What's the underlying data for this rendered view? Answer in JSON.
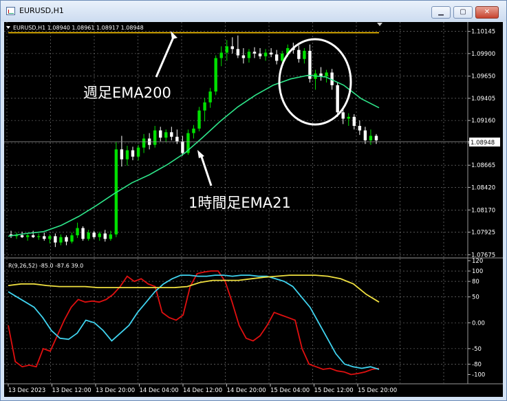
{
  "window": {
    "title": "EURUSD,H1",
    "min_glyph": "▁",
    "max_glyph": "▢",
    "close_glyph": "✕"
  },
  "main_panel": {
    "header": "EURUSD,H1  1.08940 1.08961 1.08917 1.08948",
    "price_label": "1.08948",
    "annotation_weekly": "週足EMA200",
    "annotation_hourly": "1時間足EMA21"
  },
  "sub_panel": {
    "header": "R(9,26,52) -85.0 -87.6 39.0"
  },
  "colors": {
    "background": "#000000",
    "grid": "#8a8a8a",
    "candle_bull": "#00e000",
    "candle_bear": "#ffffff",
    "ema21": "#2ee68a",
    "ema200": "#ffc800",
    "osc_red": "#e01010",
    "osc_cyan": "#40d4f0",
    "osc_yellow": "#f0e040",
    "text": "#ffffff"
  },
  "chart_data": [
    {
      "type": "candlestick",
      "title": "EURUSD,H1",
      "y_ticks": [
        "1.10145",
        "1.09900",
        "1.09650",
        "1.09405",
        "1.09160",
        "1.08910",
        "1.08665",
        "1.08420",
        "1.08170",
        "1.07925",
        "1.07675"
      ],
      "ylim": [
        1.0767,
        1.1015
      ],
      "last_price": 1.08948,
      "x_ticks": [
        "13 Dec 2023",
        "13 Dec 12:00",
        "13 Dec 20:00",
        "14 Dec 04:00",
        "14 Dec 12:00",
        "14 Dec 20:00",
        "15 Dec 04:00",
        "15 Dec 12:00",
        "15 Dec 20:00"
      ],
      "candles": [
        [
          1.079,
          1.0794,
          1.0786,
          1.0788
        ],
        [
          1.0788,
          1.0792,
          1.0785,
          1.0789
        ],
        [
          1.0789,
          1.0793,
          1.0786,
          1.0787
        ],
        [
          1.0787,
          1.0791,
          1.0783,
          1.0789
        ],
        [
          1.0789,
          1.0794,
          1.0786,
          1.0787
        ],
        [
          1.0787,
          1.0791,
          1.0784,
          1.0788
        ],
        [
          1.0788,
          1.0792,
          1.0783,
          1.0785
        ],
        [
          1.0785,
          1.079,
          1.078,
          1.0788
        ],
        [
          1.0788,
          1.0791,
          1.0776,
          1.0781
        ],
        [
          1.0781,
          1.079,
          1.0778,
          1.0787
        ],
        [
          1.0787,
          1.0789,
          1.0778,
          1.0782
        ],
        [
          1.0782,
          1.0792,
          1.078,
          1.0789
        ],
        [
          1.0789,
          1.0803,
          1.0786,
          1.0797
        ],
        [
          1.0797,
          1.0799,
          1.0783,
          1.0785
        ],
        [
          1.0785,
          1.0795,
          1.0783,
          1.0792
        ],
        [
          1.0792,
          1.0794,
          1.0785,
          1.0787
        ],
        [
          1.0787,
          1.0793,
          1.0783,
          1.0791
        ],
        [
          1.0791,
          1.0795,
          1.0782,
          1.0785
        ],
        [
          1.0785,
          1.0794,
          1.0783,
          1.079
        ],
        [
          1.079,
          1.0892,
          1.0787,
          1.0884
        ],
        [
          1.0884,
          1.0899,
          1.0865,
          1.0873
        ],
        [
          1.0873,
          1.0888,
          1.0866,
          1.0883
        ],
        [
          1.0883,
          1.0887,
          1.0872,
          1.0876
        ],
        [
          1.0876,
          1.0889,
          1.0872,
          1.0886
        ],
        [
          1.0886,
          1.0901,
          1.088,
          1.0896
        ],
        [
          1.0896,
          1.0902,
          1.0884,
          1.0889
        ],
        [
          1.0889,
          1.091,
          1.0886,
          1.0905
        ],
        [
          1.0905,
          1.0909,
          1.0893,
          1.0897
        ],
        [
          1.0897,
          1.0906,
          1.0892,
          1.0903
        ],
        [
          1.0903,
          1.0909,
          1.0894,
          1.0898
        ],
        [
          1.0898,
          1.0906,
          1.089,
          1.0893
        ],
        [
          1.0893,
          1.0899,
          1.0877,
          1.088
        ],
        [
          1.088,
          1.0906,
          1.0878,
          1.0902
        ],
        [
          1.0902,
          1.0911,
          1.0896,
          1.0907
        ],
        [
          1.0907,
          1.0931,
          1.0904,
          1.0927
        ],
        [
          1.0927,
          1.0941,
          1.0915,
          1.0936
        ],
        [
          1.0936,
          1.0952,
          1.093,
          1.0948
        ],
        [
          1.0948,
          1.0988,
          1.0944,
          1.0985
        ],
        [
          1.0985,
          1.0998,
          1.0976,
          1.0991
        ],
        [
          1.0991,
          1.1005,
          1.0982,
          1.0998
        ],
        [
          1.0998,
          1.1008,
          1.099,
          1.0995
        ],
        [
          1.0995,
          1.101,
          1.0985,
          1.0988
        ],
        [
          1.0988,
          1.0996,
          1.0979,
          1.0985
        ],
        [
          1.0985,
          1.0995,
          1.098,
          1.0992
        ],
        [
          1.0992,
          1.0997,
          1.0985,
          1.099
        ],
        [
          1.099,
          1.0996,
          1.0984,
          1.0987
        ],
        [
          1.0987,
          1.0995,
          1.0982,
          1.0991
        ],
        [
          1.0991,
          1.0996,
          1.0986,
          1.0989
        ],
        [
          1.0989,
          1.0994,
          1.0978,
          1.0982
        ],
        [
          1.0982,
          1.0993,
          1.098,
          1.099
        ],
        [
          1.099,
          1.1,
          1.0986,
          1.0996
        ],
        [
          1.0996,
          1.1002,
          1.099,
          1.0994
        ],
        [
          1.0994,
          1.0999,
          1.098,
          1.0984
        ],
        [
          1.0984,
          1.0996,
          1.0979,
          1.0993
        ],
        [
          1.0993,
          1.1,
          1.0958,
          1.0962
        ],
        [
          1.0962,
          1.0972,
          1.095,
          1.0968
        ],
        [
          1.0968,
          1.0975,
          1.096,
          1.0965
        ],
        [
          1.0965,
          1.0972,
          1.0958,
          1.0969
        ],
        [
          1.0969,
          1.0973,
          1.095,
          1.0955
        ],
        [
          1.0955,
          1.0958,
          1.092,
          1.0925
        ],
        [
          1.0925,
          1.093,
          1.0912,
          1.0918
        ],
        [
          1.0918,
          1.0924,
          1.091,
          1.092
        ],
        [
          1.092,
          1.0923,
          1.0906,
          1.091
        ],
        [
          1.091,
          1.0916,
          1.09,
          1.0905
        ],
        [
          1.0905,
          1.0909,
          1.089,
          1.0894
        ],
        [
          1.0894,
          1.0906,
          1.0889,
          1.0899
        ],
        [
          1.0899,
          1.0901,
          1.089,
          1.0894
        ]
      ],
      "series": [
        {
          "values": [
            1.0788,
            1.0791,
            1.0793,
            1.08,
            1.081,
            1.0822,
            1.0835,
            1.0847,
            1.0856,
            1.0867,
            1.088,
            1.0897,
            1.0915,
            1.0931,
            1.0944,
            1.0955,
            1.0962,
            1.0966,
            1.0964,
            1.0955,
            1.094,
            1.093
          ]
        },
        {
          "values": [
            1.1013,
            1.1013
          ]
        }
      ]
    },
    {
      "type": "line",
      "title": "R(9,26,52) -85.0 -87.6 39.0",
      "ylim": [
        -110,
        120
      ],
      "y_ticks": [
        "120",
        "100",
        "80",
        "50",
        "0.00",
        "-50",
        "-80",
        "-100"
      ],
      "series": [
        {
          "values": [
            -5,
            -75,
            -85,
            -82,
            -85,
            -50,
            -55,
            -25,
            5,
            30,
            45,
            40,
            42,
            40,
            45,
            55,
            70,
            90,
            80,
            85,
            75,
            70,
            20,
            10,
            5,
            15,
            70,
            95,
            98,
            100,
            100,
            80,
            40,
            -5,
            -30,
            -35,
            -25,
            -5,
            20,
            15,
            10,
            5,
            -50,
            -80,
            -85,
            -90,
            -88,
            -93,
            -95,
            -100,
            -98,
            -95,
            -90,
            -88
          ]
        },
        {
          "values": [
            60,
            50,
            40,
            30,
            10,
            -15,
            -30,
            -32,
            -20,
            5,
            0,
            -15,
            -35,
            -20,
            -5,
            20,
            40,
            60,
            75,
            85,
            92,
            92,
            90,
            90,
            92,
            92,
            90,
            92,
            92,
            90,
            90,
            85,
            80,
            70,
            50,
            30,
            0,
            -30,
            -60,
            -80,
            -85,
            -88,
            -85,
            -90
          ]
        },
        {
          "values": [
            72,
            75,
            75,
            72,
            70,
            70,
            70,
            68,
            68,
            68,
            68,
            68,
            68,
            68,
            70,
            78,
            82,
            82,
            82,
            85,
            88,
            90,
            92,
            92,
            92,
            90,
            85,
            75,
            55,
            40
          ]
        }
      ]
    }
  ]
}
